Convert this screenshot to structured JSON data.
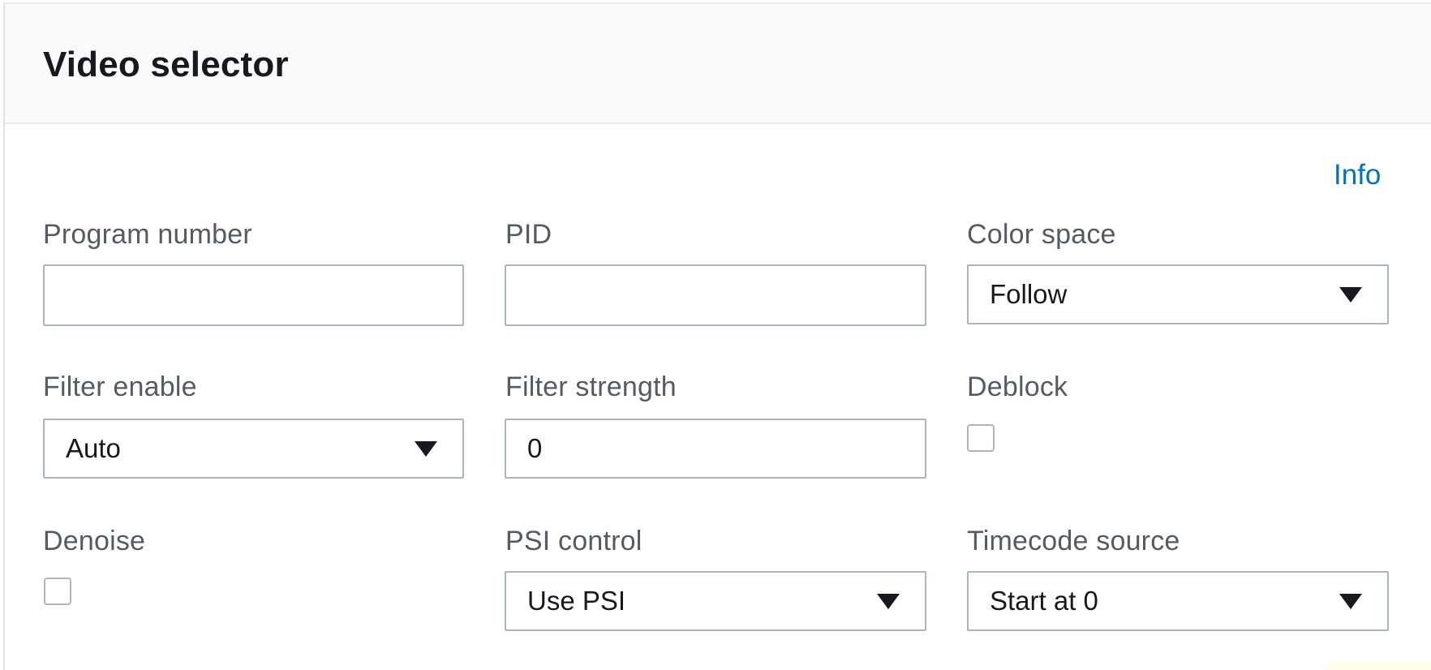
{
  "panel": {
    "title": "Video selector",
    "info_link": "Info"
  },
  "fields": {
    "program_number": {
      "label": "Program number",
      "value": ""
    },
    "pid": {
      "label": "PID",
      "value": ""
    },
    "color_space": {
      "label": "Color space",
      "value": "Follow"
    },
    "filter_enable": {
      "label": "Filter enable",
      "value": "Auto"
    },
    "filter_strength": {
      "label": "Filter strength",
      "value": "0"
    },
    "deblock": {
      "label": "Deblock",
      "checked": false
    },
    "denoise": {
      "label": "Denoise",
      "checked": false
    },
    "psi_control": {
      "label": "PSI control",
      "value": "Use PSI"
    },
    "timecode_source": {
      "label": "Timecode source",
      "value": "Start at 0"
    }
  },
  "colors": {
    "link": "#0073bb",
    "label": "#545b64",
    "text": "#16191f",
    "border": "#aab7b8",
    "header_bg": "#fafafa"
  },
  "icons": {
    "dropdown": "caret-down-icon"
  }
}
